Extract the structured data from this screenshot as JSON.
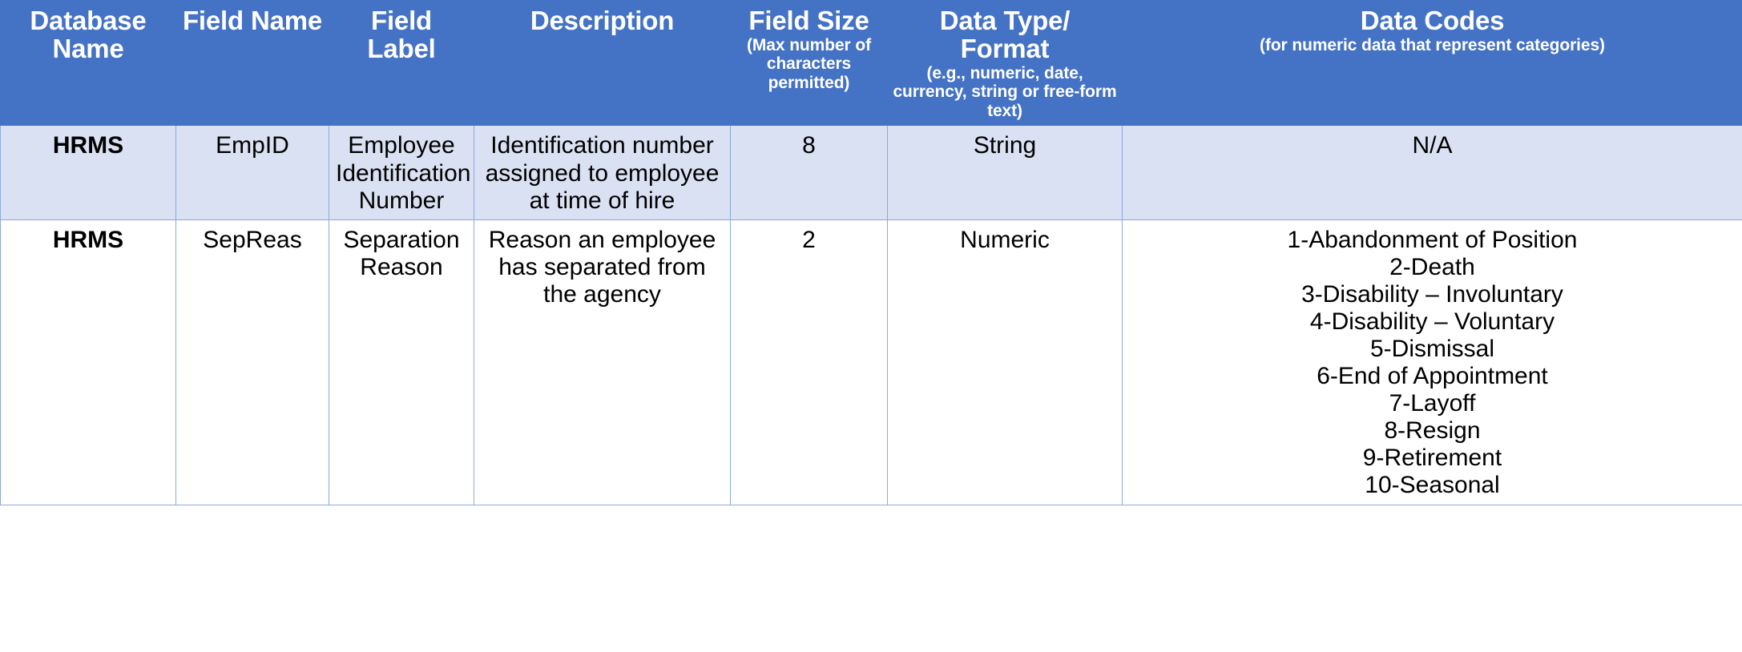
{
  "table": {
    "columns": [
      {
        "title": "Database Name",
        "subtitle": ""
      },
      {
        "title": "Field Name",
        "subtitle": ""
      },
      {
        "title": "Field Label",
        "subtitle": ""
      },
      {
        "title": "Description",
        "subtitle": ""
      },
      {
        "title": "Field Size",
        "subtitle": "(Max number of characters permitted)"
      },
      {
        "title": "Data Type/ Format",
        "subtitle": "(e.g., numeric, date, currency, string or free-form text)"
      },
      {
        "title": "Data Codes",
        "subtitle": "(for numeric data that represent categories)"
      }
    ],
    "rows": [
      {
        "database_name": "HRMS",
        "field_name": "EmpID",
        "field_label": "Employee Identification Number",
        "description": "Identification number assigned to employee at time of hire",
        "field_size": "8",
        "data_type": "String",
        "data_codes": [
          "N/A"
        ]
      },
      {
        "database_name": "HRMS",
        "field_name": "SepReas",
        "field_label": "Separation Reason",
        "description": "Reason an employee has separated from the agency",
        "field_size": "2",
        "data_type": "Numeric",
        "data_codes": [
          "1-Abandonment of Position",
          "2-Death",
          "3-Disability – Involuntary",
          "4-Disability – Voluntary",
          "5-Dismissal",
          "6-End of Appointment",
          "7-Layoff",
          "8-Resign",
          "9-Retirement",
          "10-Seasonal"
        ]
      }
    ]
  },
  "colors": {
    "header_background": "#4472C4",
    "header_text": "#FFFFFF",
    "row_shaded_background": "#D9E1F2",
    "row_plain_background": "#FFFFFF",
    "border": "#8EA9DB",
    "body_text": "#000000"
  }
}
